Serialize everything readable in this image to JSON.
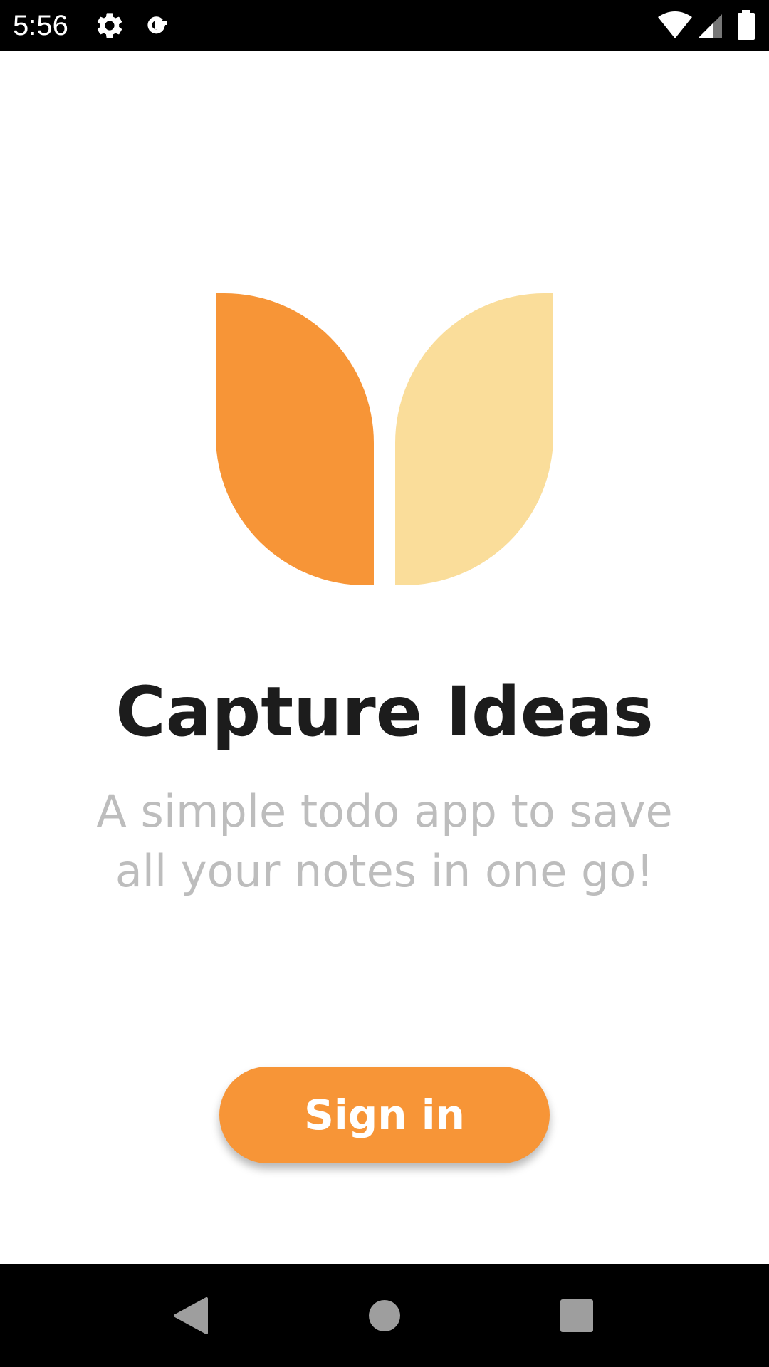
{
  "status_bar": {
    "time": "5:56",
    "icons": [
      "gear-icon",
      "google-icon",
      "wifi-icon",
      "cellular-signal-icon",
      "battery-icon"
    ]
  },
  "onboarding": {
    "logo_icon": "leaf-logo-icon",
    "title": "Capture Ideas",
    "subtitle": "A simple todo app to save all your notes in one go!",
    "sign_in_label": "Sign in"
  },
  "nav_bar": {
    "icons": [
      "back-icon",
      "home-icon",
      "recents-icon"
    ]
  },
  "colors": {
    "accent": "#f79537",
    "accent_light": "#fadd9a",
    "title": "#1c1c1c",
    "subtitle": "#bdbdbd",
    "system_bars": "#000000"
  }
}
